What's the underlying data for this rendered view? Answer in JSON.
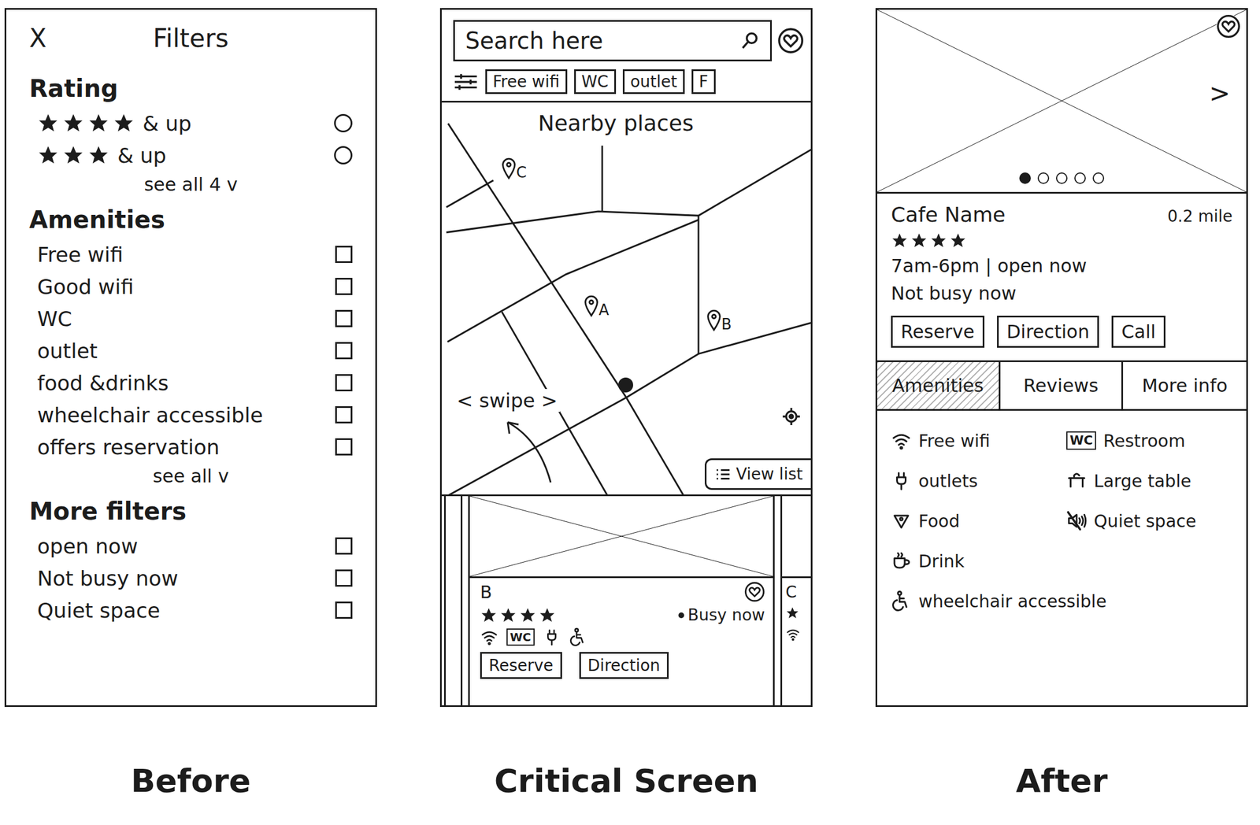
{
  "before": {
    "caption": "Before",
    "close": "X",
    "title": "Filters",
    "rating": {
      "heading": "Rating",
      "options": [
        {
          "stars": 4,
          "label": "& up",
          "selected": false
        },
        {
          "stars": 3,
          "label": "& up",
          "selected": false
        }
      ],
      "see_all": "see all 4 v"
    },
    "amenities": {
      "heading": "Amenities",
      "items": [
        {
          "label": "Free wifi",
          "checked": false
        },
        {
          "label": "Good wifi",
          "checked": false
        },
        {
          "label": "WC",
          "checked": false
        },
        {
          "label": "outlet",
          "checked": false
        },
        {
          "label": "food &drinks",
          "checked": false
        },
        {
          "label": "wheelchair accessible",
          "checked": false
        },
        {
          "label": "offers reservation",
          "checked": false
        }
      ],
      "see_all": "see all v"
    },
    "more": {
      "heading": "More filters",
      "items": [
        {
          "label": "open now",
          "checked": false
        },
        {
          "label": "Not busy now",
          "checked": false
        },
        {
          "label": "Quiet space",
          "checked": false
        }
      ]
    }
  },
  "critical": {
    "caption": "Critical Screen",
    "search": {
      "placeholder": "Search here"
    },
    "chips": [
      {
        "label": "Free wifi"
      },
      {
        "label": "WC"
      },
      {
        "label": "outlet"
      },
      {
        "label": "F"
      }
    ],
    "map": {
      "title": "Nearby places",
      "pins": [
        {
          "label": "C"
        },
        {
          "label": "A"
        },
        {
          "label": "B"
        }
      ],
      "annotation": "< swipe >",
      "view_list": "View list"
    },
    "card": {
      "name": "B",
      "stars": 4,
      "status": "Busy now",
      "amenities": [
        {
          "icon": "wifi"
        },
        {
          "icon": "wc",
          "badge": "WC"
        },
        {
          "icon": "outlet"
        },
        {
          "icon": "wheelchair"
        }
      ],
      "buttons": [
        "Reserve",
        "Direction"
      ]
    },
    "next_card": {
      "name": "C",
      "stars": 1
    }
  },
  "after": {
    "caption": "After",
    "photo": {
      "next": ">",
      "dots": [
        {
          "selected": true
        },
        {
          "selected": false
        },
        {
          "selected": false
        },
        {
          "selected": false
        },
        {
          "selected": false
        }
      ]
    },
    "name": "Cafe Name",
    "distance": "0.2 mile",
    "stars": 4,
    "hours": "7am-6pm | open now",
    "busy": "Not busy now",
    "buttons": [
      "Reserve",
      "Direction",
      "Call"
    ],
    "tabs": [
      {
        "label": "Amenities",
        "selected": true
      },
      {
        "label": "Reviews",
        "selected": false
      },
      {
        "label": "More info",
        "selected": false
      }
    ],
    "amenities": [
      {
        "label": "Free wifi",
        "icon": "wifi",
        "available": true
      },
      {
        "label": "Restroom",
        "icon": "wc",
        "badge": "WC",
        "available": true
      },
      {
        "label": "outlets",
        "icon": "outlet",
        "available": true
      },
      {
        "label": "Large table",
        "icon": "table",
        "available": true
      },
      {
        "label": "Food",
        "icon": "food",
        "available": true
      },
      {
        "label": "Quiet space",
        "icon": "quiet",
        "available": false
      },
      {
        "label": "Drink",
        "icon": "drink",
        "available": true
      },
      {
        "label": "wheelchair accessible",
        "icon": "wheelchair",
        "available": true
      }
    ]
  }
}
